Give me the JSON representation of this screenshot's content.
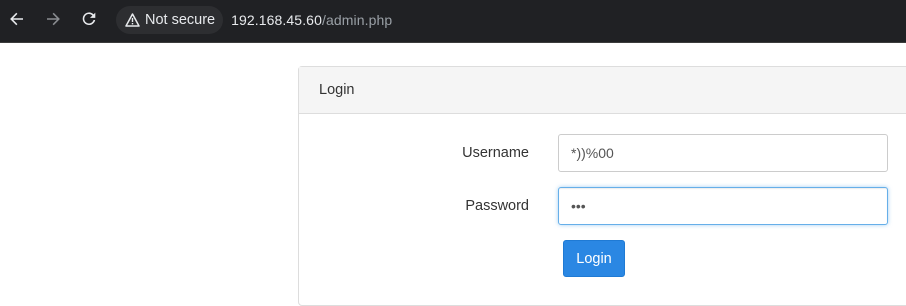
{
  "browser": {
    "security_label": "Not secure",
    "url_host": "192.168.45.60",
    "url_path": "/admin.php",
    "icons": [
      "back-arrow-icon",
      "forward-arrow-icon",
      "reload-icon",
      "warning-triangle-icon"
    ]
  },
  "login_panel": {
    "heading": "Login",
    "username": {
      "label": "Username",
      "value": "*))%00"
    },
    "password": {
      "label": "Password",
      "value": "***"
    },
    "submit_label": "Login"
  },
  "colors": {
    "browser_bar": "#202124",
    "button_primary": "#2a87e3",
    "focus_border": "#66afe9"
  }
}
